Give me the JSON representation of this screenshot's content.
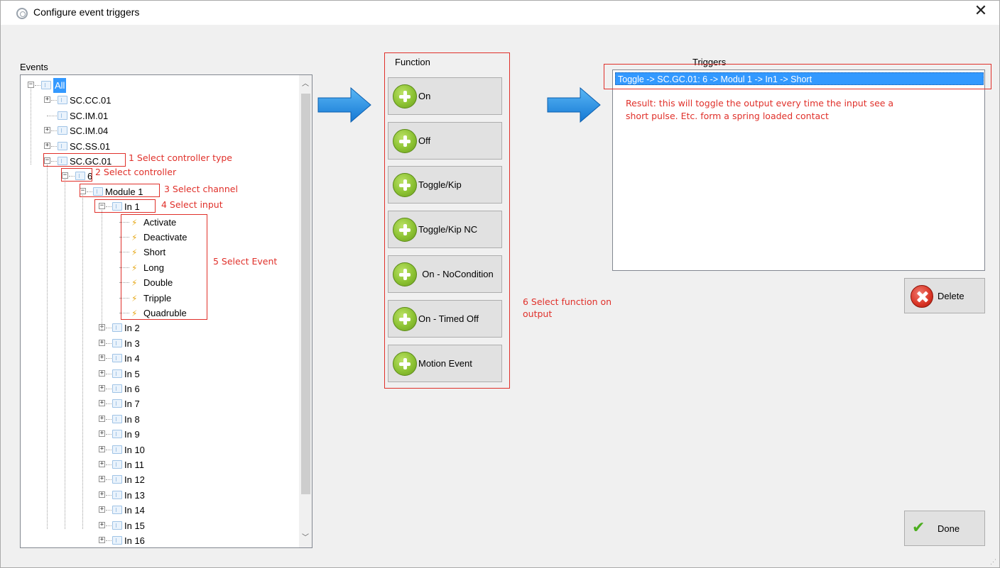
{
  "window": {
    "title": "Configure event triggers",
    "close_glyph": "✕"
  },
  "events": {
    "label": "Events",
    "root": "All",
    "nodes_level1": [
      "SC.CC.01",
      "SC.IM.01",
      "SC.IM.04",
      "SC.SS.01",
      "SC.GC.01"
    ],
    "controller": "6",
    "module": "Module 1",
    "input": "In 1",
    "event_items": [
      "Activate",
      "Deactivate",
      "Short",
      "Long",
      "Double",
      "Tripple",
      "Quadruble"
    ],
    "other_inputs": [
      "In 2",
      "In 3",
      "In 4",
      "In 5",
      "In 6",
      "In 7",
      "In 8",
      "In 9",
      "In 10",
      "In 11",
      "In 12",
      "In 13",
      "In 14",
      "In 15",
      "In 16"
    ]
  },
  "annotations": {
    "step1": "1 Select controller type",
    "step2": "2 Select controller",
    "step3": "3 Select channel",
    "step4": "4 Select input",
    "step5": "5 Select Event",
    "step6": "6 Select function on output",
    "result": "Result: this will toggle the output every time the input see a short pulse. Etc. form a spring loaded contact"
  },
  "function": {
    "label": "Function",
    "buttons": [
      "On",
      "Off",
      "Toggle/Kip",
      "Toggle/Kip NC",
      "On - NoCondition",
      "On - Timed Off",
      "Motion Event"
    ]
  },
  "triggers": {
    "label": "Triggers",
    "items": [
      "Toggle -> SC.GC.01: 6 -> Modul 1 -> In1 -> Short"
    ]
  },
  "actions": {
    "delete_label": "Delete",
    "done_label": "Done"
  },
  "colors": {
    "selection": "#3399ff",
    "annotation_red": "#e0302a",
    "arrow_blue": "#1e90e6",
    "add_green": "#8cc233"
  }
}
